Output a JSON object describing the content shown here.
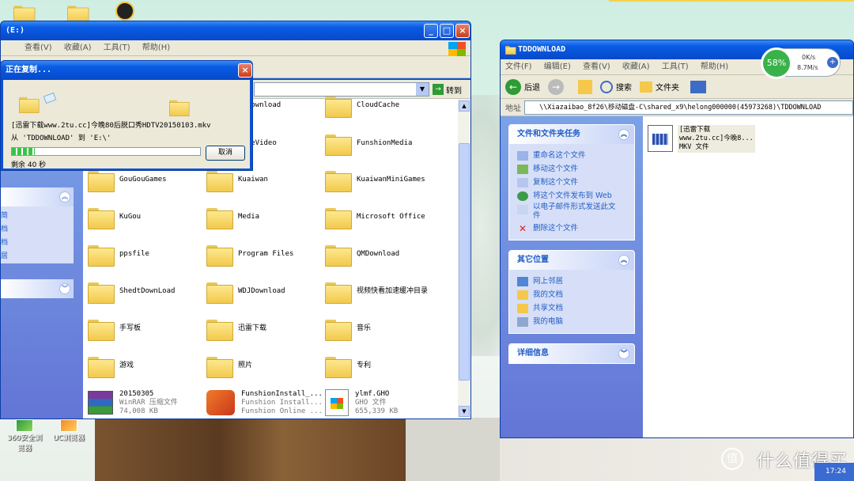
{
  "desktop": {
    "icons": [
      {
        "name": "360-browser",
        "label": "360安全浏览器"
      },
      {
        "name": "uc-browser",
        "label": "UC浏览器"
      }
    ],
    "watermark": "什么值得买",
    "watermark_badge": "值",
    "clock": "17:24"
  },
  "copy_dialog": {
    "title": "正在复制...",
    "file_name": "[迅雷下载www.2tu.cc]今晚80后脱口秀HDTV20150103.mkv",
    "from_to": "从 'TDDOWNLOAD' 到 'E:\\'",
    "progress": 0.12,
    "remaining": "剩余 40 秒",
    "cancel_label": "取消"
  },
  "left_window": {
    "title": "(E:)",
    "menu": [
      "查看(V)",
      "收藏(A)",
      "工具(T)",
      "帮助(H)"
    ],
    "go_label": "转到",
    "colors": {
      "accent": "#0a52d6"
    },
    "folders": [
      [
        "d download",
        "CloudCache"
      ],
      [
        "riteVideo",
        "FunshionMedia"
      ],
      [
        "GouGouGames",
        "Kuaiwan",
        "KuaiwanMiniGames"
      ],
      [
        "KuGou",
        "Media",
        "Microsoft Office"
      ],
      [
        "ppsfile",
        "Program Files",
        "QMDownload"
      ],
      [
        "ShedtDownLoad",
        "WDJDownload",
        "视频快看加速缓冲目录"
      ],
      [
        "手写板",
        "迅雷下载",
        "音乐"
      ],
      [
        "游戏",
        "照片",
        "专利"
      ]
    ],
    "files": [
      {
        "name": "20150305",
        "line2": "WinRAR 压缩文件",
        "line3": "74,008 KB"
      },
      {
        "name": "FunshionInstall_...",
        "line2": "Funshion Install...",
        "line3": "Funshion Online ..."
      },
      {
        "name": "ylmf.GHO",
        "line2": "GHO 文件",
        "line3": "655,339 KB"
      }
    ],
    "partial_sidebar": [
      "简",
      "档",
      "档",
      "居"
    ]
  },
  "right_window": {
    "title": "TDDOWNLOAD",
    "menu": [
      "文件(F)",
      "编辑(E)",
      "查看(V)",
      "收藏(A)",
      "工具(T)",
      "帮助(H)"
    ],
    "back_label": "后退",
    "search_label": "搜索",
    "folders_label": "文件夹",
    "address_label": "地址",
    "address_value": "\\\\Xiazaibao_8f26\\移动磁盘-C\\shared_x9\\helong000000(45973268)\\TDDOWNLOAD",
    "tasks": {
      "header": "文件和文件夹任务",
      "items": [
        "重命名这个文件",
        "移动这个文件",
        "复制这个文件",
        "将这个文件发布到 Web",
        "以电子邮件形式发送此文件",
        "删除这个文件"
      ]
    },
    "places": {
      "header": "其它位置",
      "items": [
        "网上邻居",
        "我的文档",
        "共享文档",
        "我的电脑"
      ]
    },
    "details": {
      "header": "详细信息"
    },
    "file": {
      "name": "[迅雷下载",
      "line2": "www.2tu.cc]今晚8...",
      "line3": "MKV 文件"
    }
  },
  "speed_widget": {
    "percent": "58%",
    "up": "0K/s",
    "down": "8.7M/s"
  }
}
